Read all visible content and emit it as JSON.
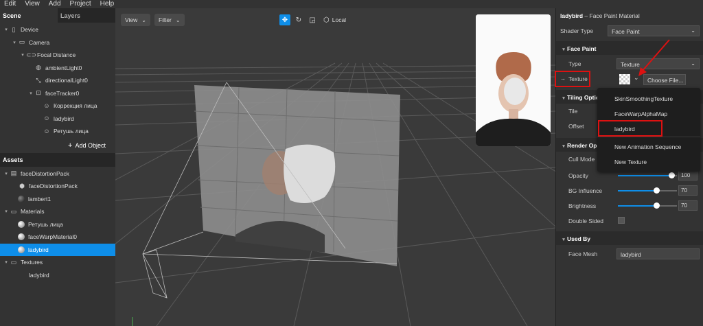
{
  "menu": [
    "Edit",
    "View",
    "Add",
    "Project",
    "Help"
  ],
  "left": {
    "tabs": [
      "Scene",
      "Layers"
    ],
    "scene_tree": [
      {
        "label": "Device",
        "indent": 0,
        "icon": "device-icon",
        "expanded": true
      },
      {
        "label": "Camera",
        "indent": 1,
        "icon": "camera-icon",
        "expanded": true
      },
      {
        "label": "Focal Distance",
        "indent": 2,
        "icon": "focal-distance-icon",
        "expanded": true
      },
      {
        "label": "ambientLight0",
        "indent": 3,
        "icon": "globe-light-icon",
        "expanded": null
      },
      {
        "label": "directionalLight0",
        "indent": 3,
        "icon": "directional-light-icon",
        "expanded": null
      },
      {
        "label": "faceTracker0",
        "indent": 3,
        "icon": "face-tracker-icon",
        "expanded": true
      },
      {
        "label": "Коррекция лица",
        "indent": 4,
        "icon": "face-mesh-icon",
        "expanded": null
      },
      {
        "label": "ladybird",
        "indent": 4,
        "icon": "face-mesh-icon",
        "expanded": null
      },
      {
        "label": "Ретушь лица",
        "indent": 4,
        "icon": "face-mesh-icon",
        "expanded": null
      }
    ],
    "add_object": "Add Object",
    "assets_title": "Assets",
    "assets_tree": [
      {
        "label": "faceDistortionPack",
        "indent": 0,
        "icon": "file-icon",
        "expanded": true,
        "selected": false
      },
      {
        "label": "faceDistortionPack",
        "indent": 1,
        "icon": "cube-icon",
        "expanded": null,
        "selected": false
      },
      {
        "label": "lambert1",
        "indent": 1,
        "icon": "material-sphere-dark-icon",
        "expanded": null,
        "selected": false
      },
      {
        "label": "Materials",
        "indent": 0,
        "icon": "folder-icon",
        "expanded": true,
        "selected": false
      },
      {
        "label": "Ретушь лица",
        "indent": 1,
        "icon": "material-sphere-icon",
        "expanded": null,
        "selected": false
      },
      {
        "label": "faceWarpMaterial0",
        "indent": 1,
        "icon": "material-sphere-icon",
        "expanded": null,
        "selected": false
      },
      {
        "label": "ladybird",
        "indent": 1,
        "icon": "material-sphere-icon",
        "expanded": null,
        "selected": true
      },
      {
        "label": "Textures",
        "indent": 0,
        "icon": "folder-icon",
        "expanded": true,
        "selected": false
      },
      {
        "label": "ladybird",
        "indent": 1,
        "icon": "",
        "expanded": null,
        "selected": false
      }
    ]
  },
  "viewport": {
    "view_label": "View",
    "filter_label": "Filter",
    "local_label": "Local",
    "tools": [
      "move-icon",
      "rotate-icon",
      "scale-icon"
    ]
  },
  "inspector": {
    "title_name": "ladybird",
    "title_suffix": " – Face Paint Material",
    "shader_type_label": "Shader Type",
    "shader_type_value": "Face Paint",
    "face_paint_section": "Face Paint",
    "type_label": "Type",
    "type_value": "Texture",
    "texture_label": "Texture",
    "choose_file": "Choose File...",
    "tiling_section": "Tiling Optio",
    "tile_label": "Tile",
    "offset_label": "Offset",
    "render_section": "Render Op",
    "cull_mode_label": "Cull Mode",
    "opacity_label": "Opacity",
    "opacity_value": "100",
    "bg_influence_label": "BG Influence",
    "bg_influence_value": "70",
    "brightness_label": "Brightness",
    "brightness_value": "70",
    "double_sided_label": "Double Sided",
    "used_by_section": "Used By",
    "face_mesh_label": "Face Mesh",
    "face_mesh_value": "ladybird"
  },
  "texture_dropdown": {
    "items": [
      "SkinSmoothingTexture",
      "FaceWarpAlphaMap",
      "ladybird",
      "New Animation Sequence",
      "New Texture"
    ],
    "highlighted": "ladybird"
  },
  "colors": {
    "accent": "#0e8ee9",
    "highlight_red": "#dd1111"
  }
}
